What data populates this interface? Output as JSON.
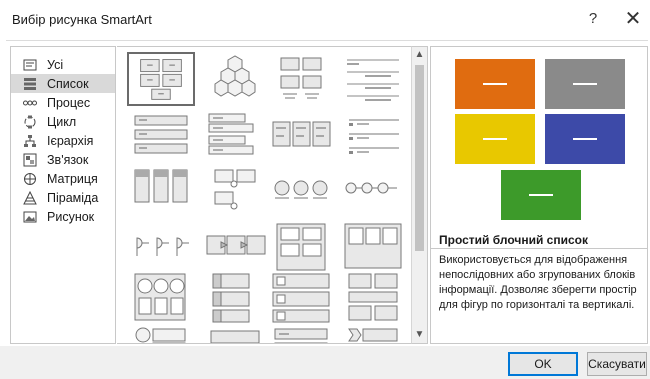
{
  "window": {
    "title": "Вибір рисунка SmartArt",
    "help_label": "?",
    "close_label": "✕"
  },
  "categories": [
    {
      "label": "Усі",
      "icon": "all-icon",
      "selected": false
    },
    {
      "label": "Список",
      "icon": "list-icon",
      "selected": true
    },
    {
      "label": "Процес",
      "icon": "process-icon",
      "selected": false
    },
    {
      "label": "Цикл",
      "icon": "cycle-icon",
      "selected": false
    },
    {
      "label": "Ієрархія",
      "icon": "hierarchy-icon",
      "selected": false
    },
    {
      "label": "Зв'язок",
      "icon": "relationship-icon",
      "selected": false
    },
    {
      "label": "Матриця",
      "icon": "matrix-icon",
      "selected": false
    },
    {
      "label": "Піраміда",
      "icon": "pyramid-icon",
      "selected": false
    },
    {
      "label": "Рисунок",
      "icon": "picture-icon",
      "selected": false
    }
  ],
  "gallery": {
    "selected_index": 0,
    "item_count": 24
  },
  "scrollbar": {
    "up_label": "^",
    "down_label": "v"
  },
  "preview": {
    "colors": [
      "#e06c10",
      "#8a8a8a",
      "#e8c800",
      "#3d4aa8",
      "#3d9a2a"
    ],
    "title": "Простий блочний список",
    "description": "Використовується для відображення непослідовних або згрупованих блоків інформації. Дозволяє зберегти простір для фігур по горизонталі та вертикалі."
  },
  "buttons": {
    "ok": "OK",
    "cancel": "Скасувати"
  }
}
